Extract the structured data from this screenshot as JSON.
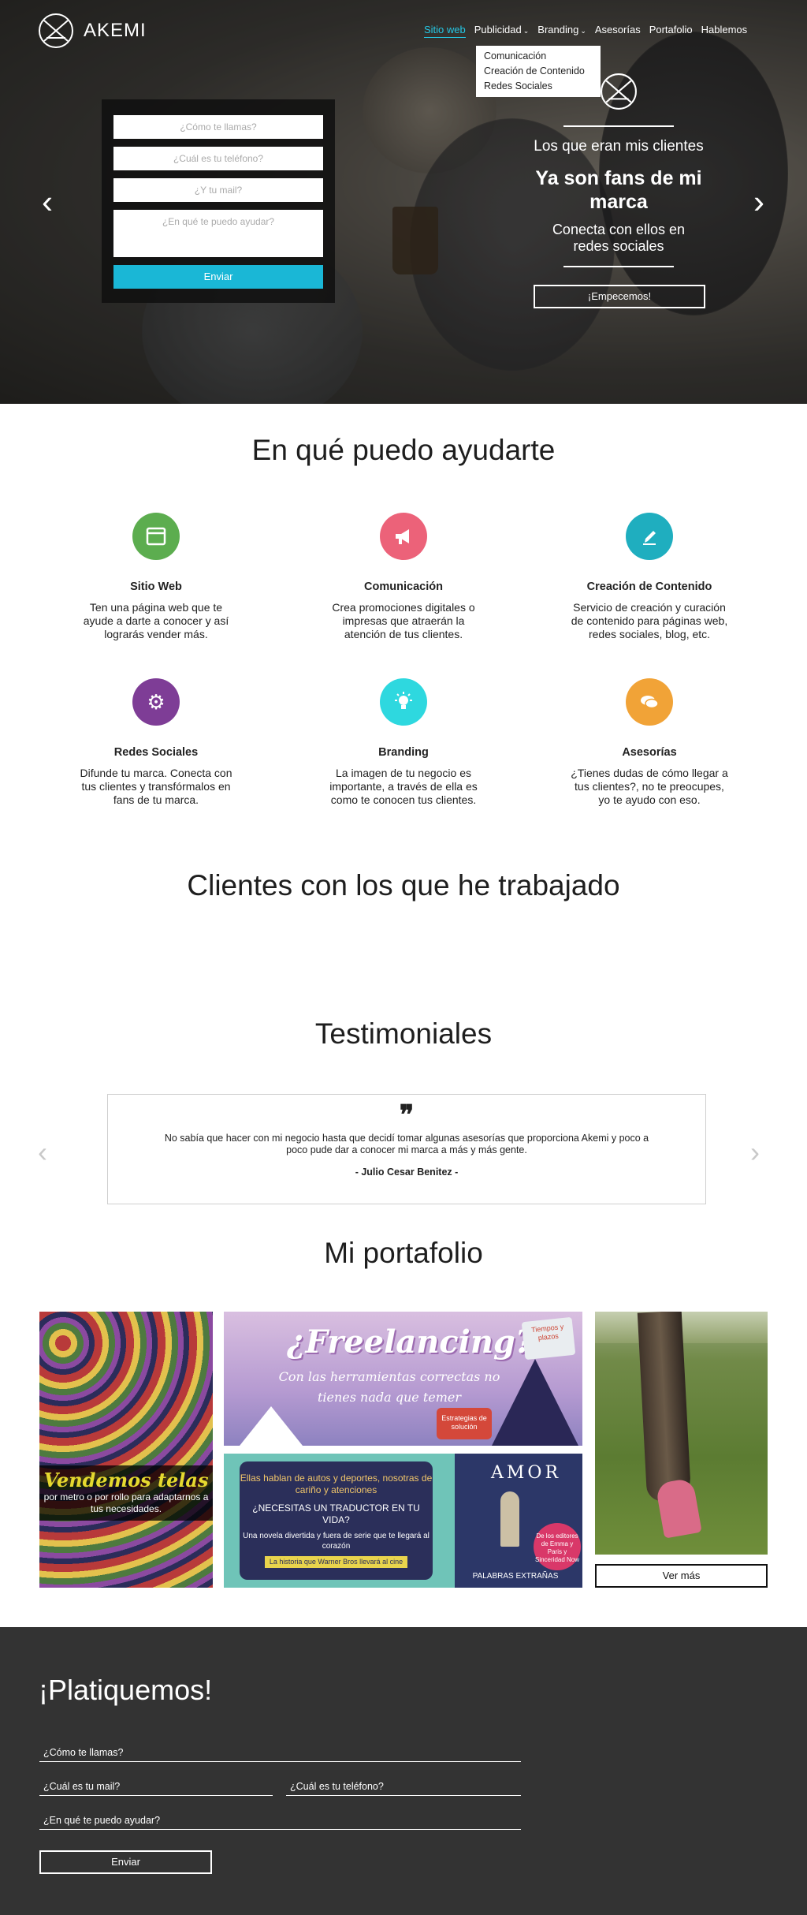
{
  "brand": {
    "name": "AKEMI"
  },
  "nav": {
    "items": [
      {
        "label": "Sitio web",
        "active": true
      },
      {
        "label": "Publicidad",
        "dropdown": true
      },
      {
        "label": "Branding",
        "dropdown": true
      },
      {
        "label": "Asesorías"
      },
      {
        "label": "Portafolio"
      },
      {
        "label": "Hablemos"
      }
    ],
    "dropdown_items": [
      "Comunicación",
      "Creación de Contenido",
      "Redes Sociales"
    ]
  },
  "hero_form": {
    "name_placeholder": "¿Cómo te llamas?",
    "phone_placeholder": "¿Cuál es tu teléfono?",
    "mail_placeholder": "¿Y tu mail?",
    "help_placeholder": "¿En qué te puedo ayudar?",
    "submit_label": "Enviar"
  },
  "hero_promo": {
    "line1": "Los que eran mis  clientes",
    "line2": "Ya son fans de mi marca",
    "line3": "Conecta con ellos en redes sociales",
    "cta_label": "¡Empecemos!"
  },
  "services": {
    "title": "En qué puedo ayudarte",
    "items": [
      {
        "name": "Sitio Web",
        "desc": "Ten una página web que te ayude a darte a conocer y así lograrás vender más.",
        "color": "#5cad4f",
        "icon": "browser-icon"
      },
      {
        "name": "Comunicación",
        "desc": "Crea promociones digitales o impresas que atraerán la atención de tus clientes.",
        "color": "#ec6279",
        "icon": "megaphone-icon"
      },
      {
        "name": "Creación de Contenido",
        "desc": "Servicio de creación y curación de contenido para páginas web, redes sociales, blog, etc.",
        "color": "#1faebf",
        "icon": "pencil-icon"
      },
      {
        "name": "Redes Sociales",
        "desc": "Difunde tu marca. Conecta con tus clientes y transfórmalos en fans de tu marca.",
        "color": "#7e3d96",
        "icon": "gears-icon"
      },
      {
        "name": "Branding",
        "desc": "La imagen de tu negocio es importante, a través de ella es como te conocen tus clientes.",
        "color": "#2ed8df",
        "icon": "lightbulb-icon"
      },
      {
        "name": "Asesorías",
        "desc": "¿Tienes dudas de cómo llegar  a tus clientes?, no te preocupes, yo te ayudo con eso.",
        "color": "#f1a337",
        "icon": "chat-bubbles-icon"
      }
    ]
  },
  "clients": {
    "title": "Clientes con los que he trabajado"
  },
  "testimonials": {
    "title": "Testimoniales",
    "quote": "No sabía que hacer con mi negocio hasta que decidí tomar algunas asesorías que proporciona Akemi y poco a poco pude dar a conocer mi marca a más y más gente.",
    "author": "- Julio Cesar Benitez -"
  },
  "portfolio": {
    "title": "Mi portafolio",
    "telas": {
      "headline": "Vendemos telas",
      "sub": "por metro o por rollo para adaptarnos a tus necesidades."
    },
    "freelancing": {
      "headline": "¿Freelancing?",
      "sub": "Con las herramientas correctas no tienes nada que temer",
      "sticker": "Tiempos y plazos",
      "badge": "Estrategias de solución"
    },
    "traductor": {
      "line1": "Ellas hablan de autos y deportes, nosotras de cariño y atenciones",
      "line2": "¿NECESITAS UN TRADUCTOR EN TU VIDA?",
      "line3": "Una novela divertida y fuera de serie que te llegará al corazón",
      "line4": "La historia que Warner Bros llevará al cine"
    },
    "amor": {
      "title": "AMOR",
      "circle": "De los editores de Emma y Paris y Sinceridad Now",
      "foot": "PALABRAS EXTRAÑAS"
    },
    "more_label": "Ver más"
  },
  "contact": {
    "title": "¡Platiquemos!",
    "name_label": "¿Cómo te llamas?",
    "mail_label": "¿Cuál es tu mail?",
    "phone_label": "¿Cuál es tu teléfono?",
    "help_label": "¿En qué te puedo ayudar?",
    "submit_label": "Enviar"
  }
}
